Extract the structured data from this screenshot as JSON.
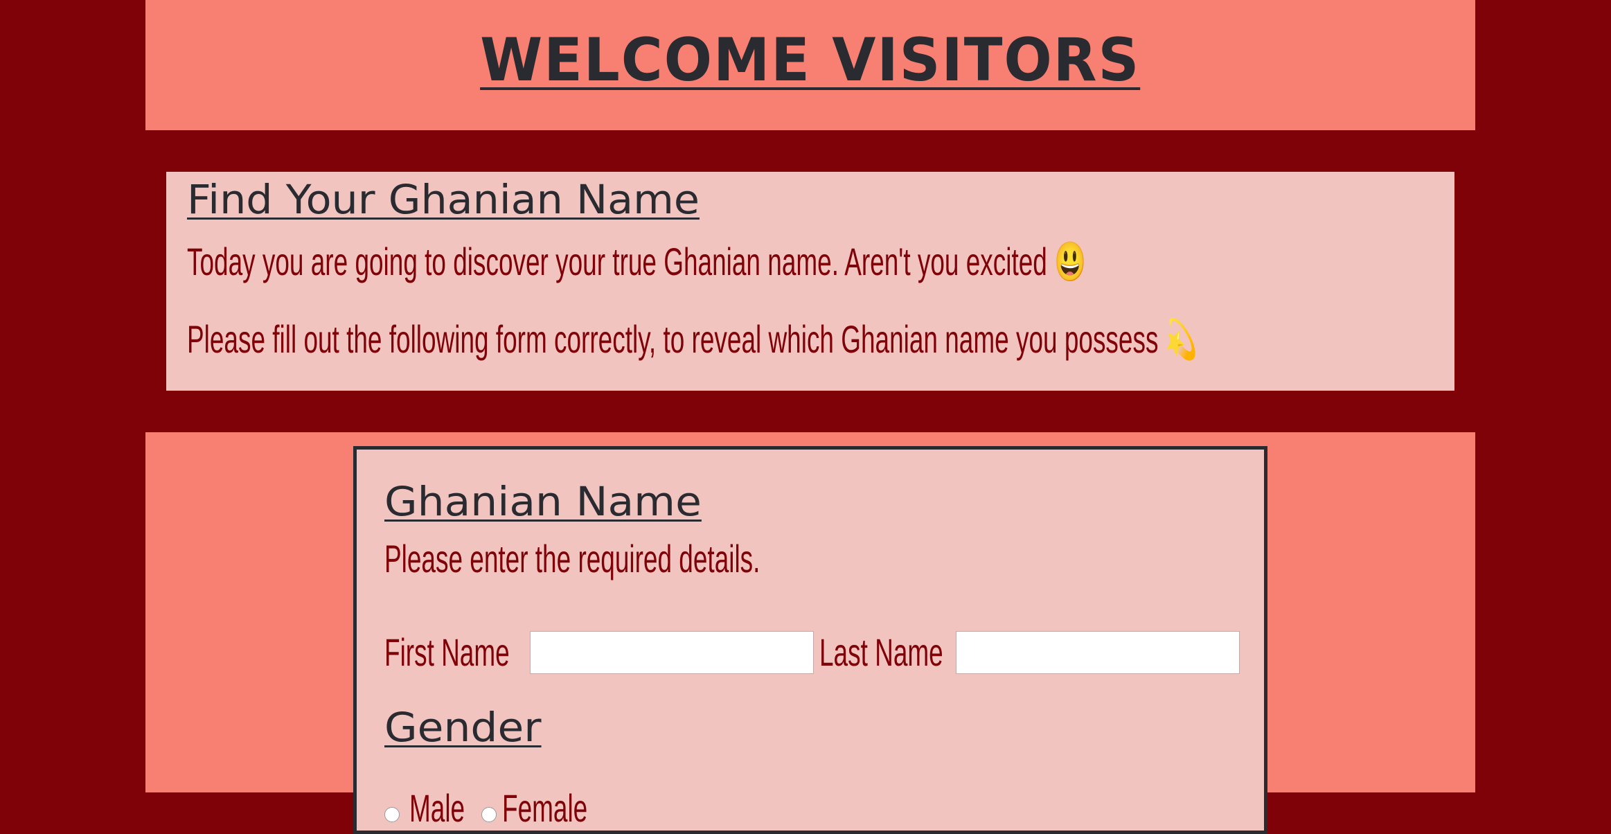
{
  "header": {
    "title": "WELCOME VISITORS"
  },
  "intro": {
    "heading": "Find Your Ghanian Name",
    "line1": "Today you are going to discover your true Ghanian name. Aren't you excited 😃",
    "line2": "Please fill out the following form correctly, to reveal which Ghanian name you possess 💫"
  },
  "form": {
    "heading": "Ghanian Name",
    "note": "Please enter the required details.",
    "first_name_label": "First Name",
    "first_name_value": "",
    "last_name_label": "Last Name",
    "last_name_value": "",
    "gender_heading": "Gender",
    "gender_options": [
      "Male",
      "Female"
    ]
  },
  "colors": {
    "page_background": "#7f0209",
    "band_background": "#f88072",
    "card_background": "#f2c4bf",
    "heading_text": "#2a2b30",
    "body_text": "#7f0209"
  }
}
